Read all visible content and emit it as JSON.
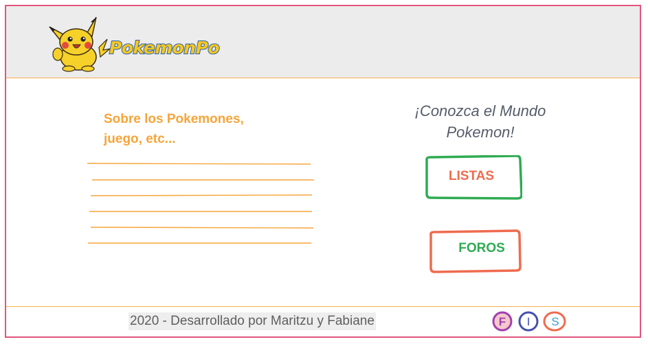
{
  "header": {
    "logo_text": "PokemonPo"
  },
  "about": {
    "text": "Sobre los Pokemones, juego, etc..."
  },
  "welcome": {
    "line1": "¡Conozca el Mundo",
    "line2": "Pokemon!"
  },
  "buttons": {
    "listas": "LISTAS",
    "foros": "FOROS"
  },
  "footer": {
    "credit": "2020 - Desarrollado por Maritzu y Fabiane",
    "social": [
      {
        "label": "F"
      },
      {
        "label": "I"
      },
      {
        "label": "S"
      }
    ]
  },
  "colors": {
    "frame": "#e0557d",
    "accent_orange": "#f6a53a",
    "green": "#2fab52",
    "orange_red": "#ef6b4f",
    "pikachu_yellow": "#f6d12a"
  }
}
